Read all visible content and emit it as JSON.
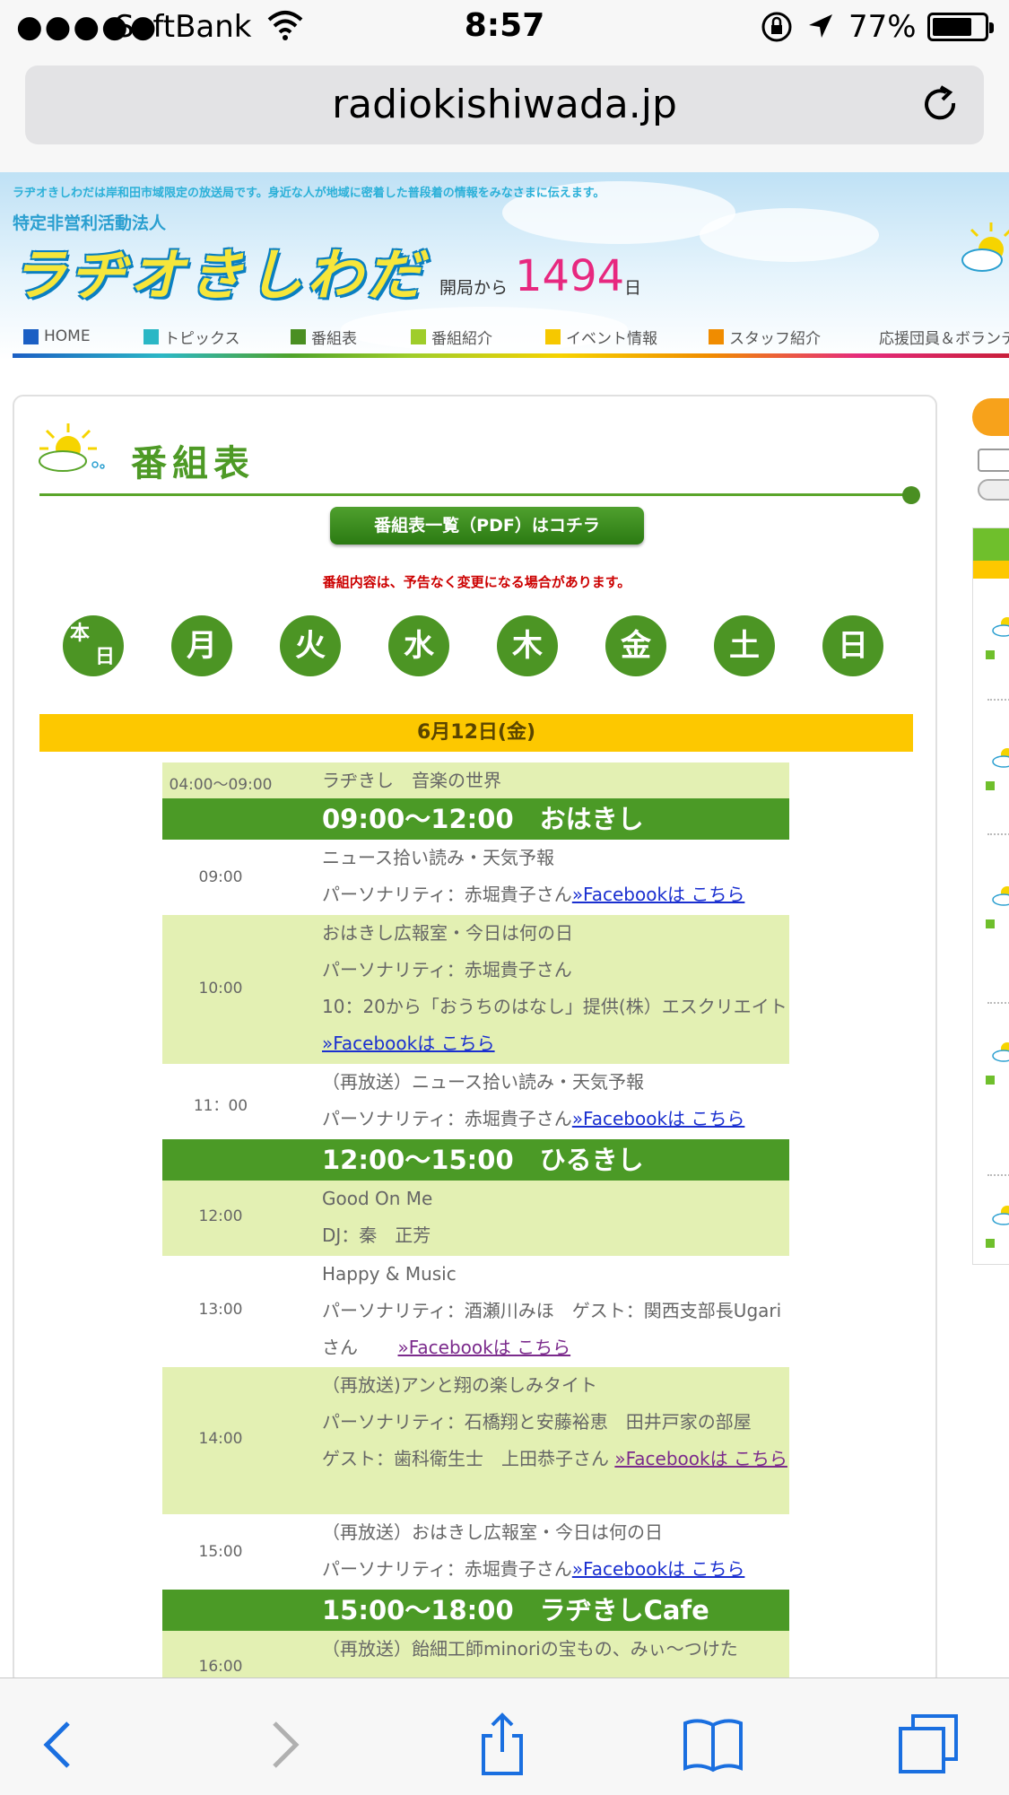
{
  "status_bar": {
    "signal": "●●●●●",
    "carrier": "SoftBank",
    "time": "8:57",
    "battery_pct": "77%",
    "battery_level": 0.77
  },
  "browser": {
    "url": "radiokishiwada.jp"
  },
  "header": {
    "tagline": "ラヂオきしわだは岸和田市域限定の放送局です。身近な人が地域に密着した普段着の情報をみなさまに伝えます。",
    "npo": "特定非営利活動法人",
    "logo": "ラヂオきしわだ",
    "since_label": "開局から",
    "day_count": "1494",
    "day_unit": "日"
  },
  "nav": [
    {
      "label": "HOME",
      "color": "#1b5fc4"
    },
    {
      "label": "トピックス",
      "color": "#2bb7c5"
    },
    {
      "label": "番組表",
      "color": "#4a8f22"
    },
    {
      "label": "番組紹介",
      "color": "#9fcd2a"
    },
    {
      "label": "イベント情報",
      "color": "#f6c800"
    },
    {
      "label": "スタッフ紹介",
      "color": "#f08c00"
    },
    {
      "label": "応援団員＆ボランティア募集",
      "color": "#f25ca9"
    }
  ],
  "page": {
    "title": "番組表",
    "pdf_button": "番組表一覧（PDF）はコチラ",
    "notice": "番組内容は、予告なく変更になる場合があります。",
    "days": [
      "月",
      "火",
      "水",
      "木",
      "金",
      "土",
      "日"
    ],
    "today_top": "本",
    "today_bottom": "日",
    "date": "6月12日(金)"
  },
  "schedule": {
    "r0": {
      "time": "04:00～09:00",
      "l1": "ラヂきし　音楽の世界"
    },
    "h1": "09:00～12:00　おはきし",
    "r1": {
      "time": "09:00",
      "l1": "ニュース拾い読み・天気予報",
      "l2": "パーソナリティ：赤堀貴子さん",
      "link": "»Facebookは こちら"
    },
    "r2": {
      "time": "10:00",
      "l1": "おはきし広報室・今日は何の日",
      "l2": "パーソナリティ：赤堀貴子さん",
      "l3": "10：20から「おうちのはなし」提供(株）エスクリエイト",
      "link": "»Facebookは こちら"
    },
    "r3": {
      "time": "11：00",
      "l1": "（再放送）ニュース拾い読み・天気予報",
      "l2": "パーソナリティ：赤堀貴子さん",
      "link": "»Facebookは こちら"
    },
    "h2": "12:00～15:00　ひるきし",
    "r4": {
      "time": "12:00",
      "l1": "Good On Me",
      "l2": "DJ：秦　正芳"
    },
    "r5": {
      "time": "13:00",
      "l1": "Happy & Music",
      "l2": "パーソナリティ：酒瀬川みほ　ゲスト：関西支部長Ugariさん",
      "link": "»Facebookは こちら"
    },
    "r6": {
      "time": "14:00",
      "l1": "（再放送)アンと翔の楽しみタイト",
      "l2": "パーソナリティ：石橋翔と安藤裕恵　田井戸家の部屋",
      "l3": "ゲスト：歯科衛生士　上田恭子さん",
      "link": "»Facebookは こちら"
    },
    "r7": {
      "time": "15:00",
      "l1": "（再放送）おはきし広報室・今日は何の日",
      "l2": "パーソナリティ：赤堀貴子さん",
      "link": "»Facebookは こちら"
    },
    "h3": "15:00～18:00　ラヂきしCafe",
    "r8": {
      "time": "16:00",
      "l1": "（再放送）飴細工師minoriの宝もの、みぃ～つけた"
    }
  }
}
